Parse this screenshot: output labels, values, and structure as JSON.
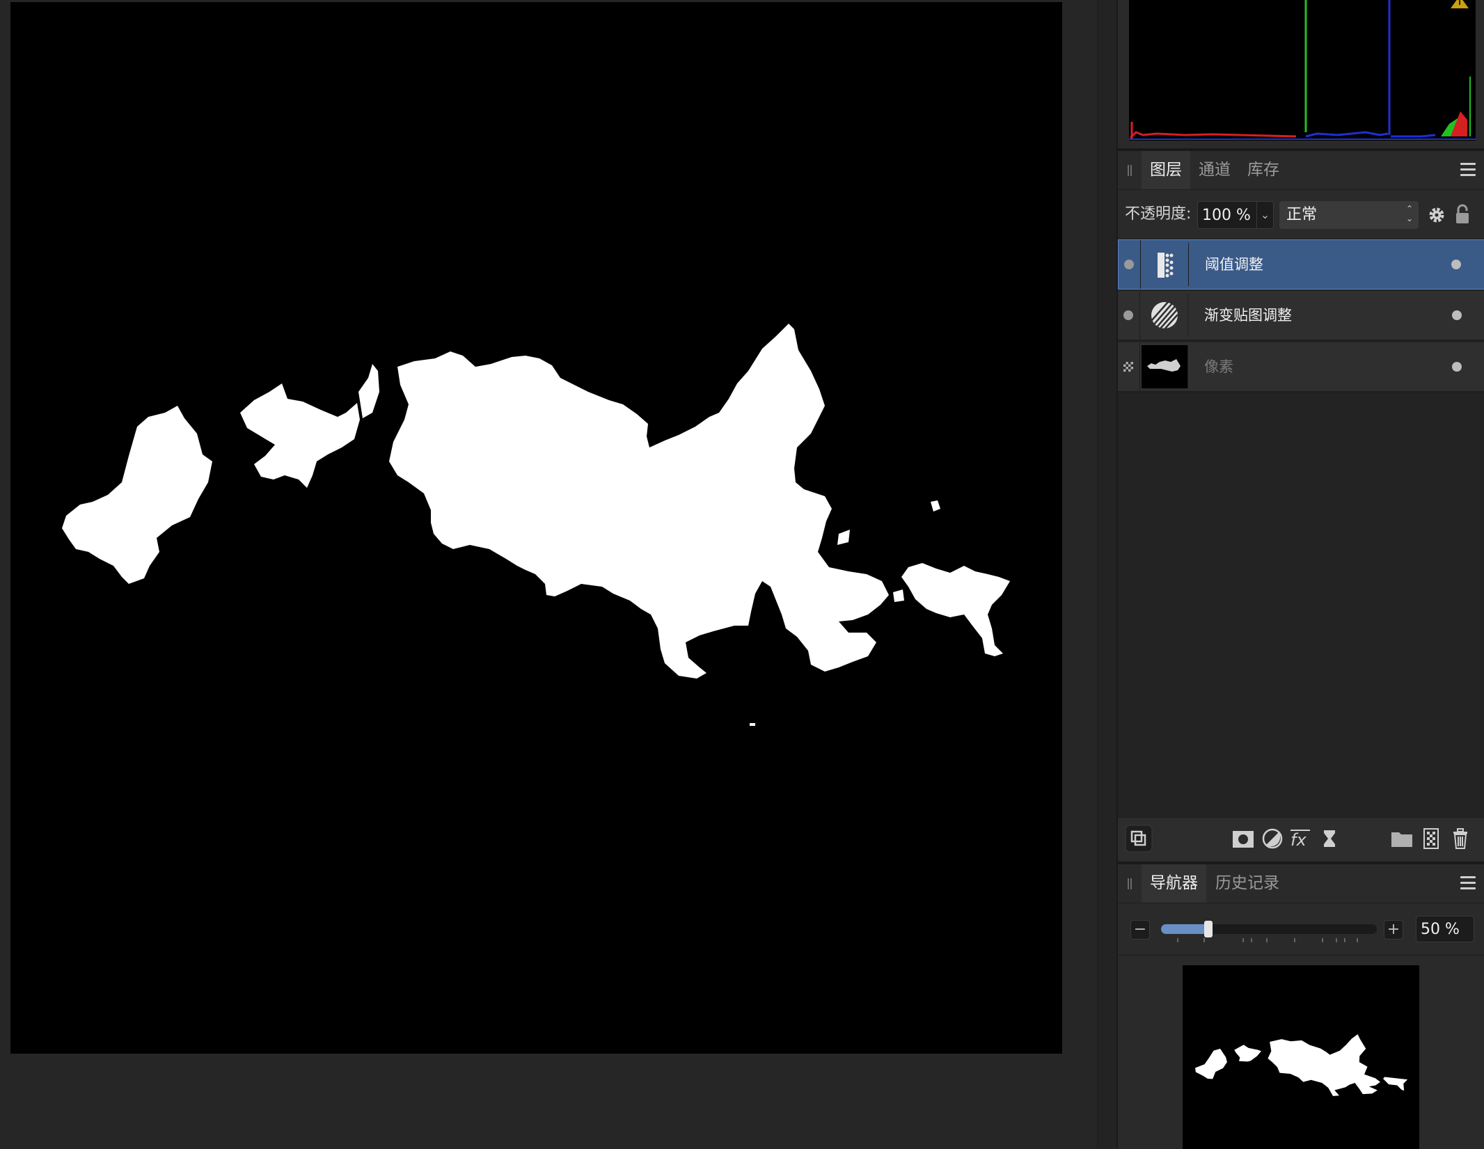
{
  "canvas": {
    "background": "#000000",
    "shape_color": "#ffffff"
  },
  "histogram": {
    "warning_icon": "warning-triangle-icon",
    "channels": [
      "red",
      "green",
      "blue"
    ]
  },
  "layers_panel": {
    "tabs": [
      {
        "label": "图层",
        "active": true
      },
      {
        "label": "通道",
        "active": false
      },
      {
        "label": "库存",
        "active": false
      }
    ],
    "opacity_label": "不透明度:",
    "opacity_value": "100 %",
    "blend_mode": "正常",
    "layers": [
      {
        "name": "阈值调整",
        "icon": "threshold-adjustment-icon",
        "selected": true,
        "dimmed": false
      },
      {
        "name": "渐变贴图调整",
        "icon": "gradient-map-adjustment-icon",
        "selected": false,
        "dimmed": false
      },
      {
        "name": "像素",
        "icon": "pixel-layer-thumbnail",
        "selected": false,
        "dimmed": true
      }
    ],
    "toolbar_icons": [
      "layer-effects-toggle-icon",
      "mask-icon",
      "adjustment-icon",
      "fx-icon",
      "live-filter-icon",
      "group-folder-icon",
      "new-pixel-layer-icon",
      "trash-icon"
    ]
  },
  "navigator_panel": {
    "tabs": [
      {
        "label": "导航器",
        "active": true
      },
      {
        "label": "历史记录",
        "active": false
      }
    ],
    "zoom_value": "50 %",
    "zoom_fraction": 0.2,
    "minus_label": "−",
    "plus_label": "+"
  }
}
